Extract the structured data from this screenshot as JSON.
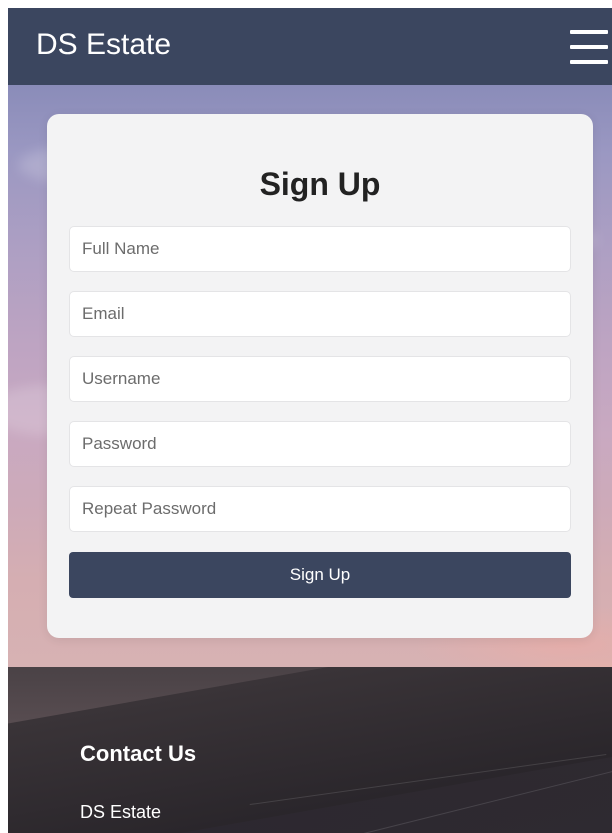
{
  "header": {
    "brand": "DS Estate",
    "menu_icon": "hamburger-menu-icon",
    "background_color": "#3b465f"
  },
  "signup_form": {
    "title": "Sign Up",
    "fields": {
      "full_name": {
        "placeholder": "Full Name",
        "value": ""
      },
      "email": {
        "placeholder": "Email",
        "value": ""
      },
      "username": {
        "placeholder": "Username",
        "value": ""
      },
      "password": {
        "placeholder": "Password",
        "value": ""
      },
      "repeat_password": {
        "placeholder": "Repeat Password",
        "value": ""
      }
    },
    "submit_label": "Sign Up",
    "button_color": "#3b465f"
  },
  "footer": {
    "title": "Contact Us",
    "company": "DS Estate"
  }
}
